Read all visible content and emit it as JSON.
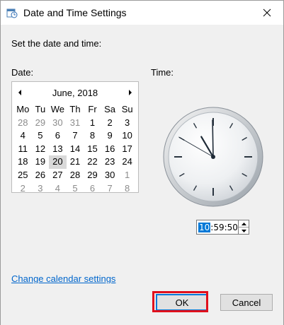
{
  "window": {
    "title": "Date and Time Settings"
  },
  "heading": "Set the date and time:",
  "labels": {
    "date": "Date:",
    "time": "Time:"
  },
  "calendar": {
    "month_label": "June, 2018",
    "weekdays": [
      "Mo",
      "Tu",
      "We",
      "Th",
      "Fr",
      "Sa",
      "Su"
    ],
    "weeks": [
      [
        {
          "d": "28",
          "o": true
        },
        {
          "d": "29",
          "o": true
        },
        {
          "d": "30",
          "o": true
        },
        {
          "d": "31",
          "o": true
        },
        {
          "d": "1"
        },
        {
          "d": "2"
        },
        {
          "d": "3"
        }
      ],
      [
        {
          "d": "4"
        },
        {
          "d": "5"
        },
        {
          "d": "6"
        },
        {
          "d": "7"
        },
        {
          "d": "8"
        },
        {
          "d": "9"
        },
        {
          "d": "10"
        }
      ],
      [
        {
          "d": "11"
        },
        {
          "d": "12"
        },
        {
          "d": "13"
        },
        {
          "d": "14"
        },
        {
          "d": "15"
        },
        {
          "d": "16"
        },
        {
          "d": "17"
        }
      ],
      [
        {
          "d": "18"
        },
        {
          "d": "19"
        },
        {
          "d": "20",
          "today": true
        },
        {
          "d": "21"
        },
        {
          "d": "22"
        },
        {
          "d": "23"
        },
        {
          "d": "24"
        }
      ],
      [
        {
          "d": "25"
        },
        {
          "d": "26"
        },
        {
          "d": "27"
        },
        {
          "d": "28"
        },
        {
          "d": "29"
        },
        {
          "d": "30"
        },
        {
          "d": "1",
          "o": true
        }
      ],
      [
        {
          "d": "2",
          "o": true
        },
        {
          "d": "3",
          "o": true
        },
        {
          "d": "4",
          "o": true
        },
        {
          "d": "5",
          "o": true
        },
        {
          "d": "6",
          "o": true
        },
        {
          "d": "7",
          "o": true
        },
        {
          "d": "8",
          "o": true
        }
      ]
    ]
  },
  "time": {
    "hours": "10",
    "minutes": "59",
    "seconds": "50",
    "separator": ":"
  },
  "clock": {
    "hour": 10,
    "minute": 59,
    "second": 50
  },
  "link": {
    "change_calendar": "Change calendar settings"
  },
  "buttons": {
    "ok": "OK",
    "cancel": "Cancel"
  },
  "colors": {
    "accent": "#0078d7",
    "highlight": "#e0101c",
    "link": "#0066cc"
  }
}
